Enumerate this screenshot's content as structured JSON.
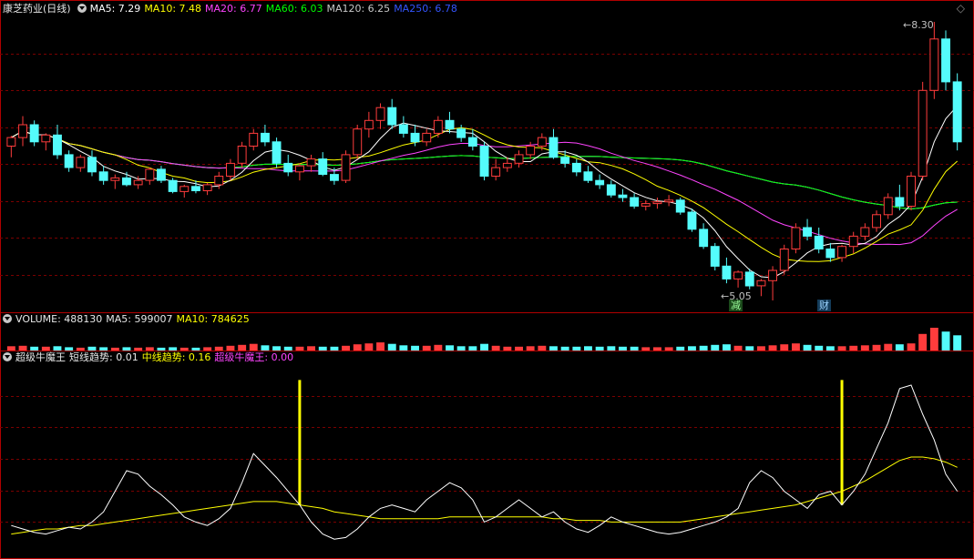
{
  "main": {
    "stock_name": "康芝药业(日线)",
    "ma_labels": [
      {
        "label": "MA5: 7.29",
        "color": "#ffffff"
      },
      {
        "label": "MA10: 7.48",
        "color": "#ffff00"
      },
      {
        "label": "MA20: 6.77",
        "color": "#ff44ff"
      },
      {
        "label": "MA60: 6.03",
        "color": "#00ff00"
      },
      {
        "label": "MA120: 6.25",
        "color": "#c8c8c8"
      },
      {
        "label": "MA250: 6.78",
        "color": "#3355ff"
      }
    ],
    "high_marker": "8.30",
    "low_marker": "5.05",
    "event_reduce": "减",
    "event_finance": "财"
  },
  "volume": {
    "title": "VOLUME: 488130",
    "ma5": "MA5: 599007",
    "ma10": "MA10: 784625"
  },
  "indicator": {
    "title": "超级牛魔王",
    "short": "短线趋势: 0.01",
    "mid": "中线趋势: 0.16",
    "king": "超级牛魔王: 0.00"
  },
  "colors": {
    "up": "#ff3c3c",
    "down": "#54fcfc",
    "grid": "#7a0000",
    "border": "#b00000"
  },
  "chart_data": {
    "type": "candlestick",
    "y_range": [
      5.05,
      8.3
    ],
    "candles": [
      [
        6.85,
        6.97,
        6.72,
        6.95
      ],
      [
        6.95,
        7.2,
        6.85,
        7.1
      ],
      [
        7.1,
        7.15,
        6.85,
        6.9
      ],
      [
        6.9,
        7.0,
        6.8,
        6.98
      ],
      [
        6.98,
        7.1,
        6.7,
        6.75
      ],
      [
        6.75,
        6.8,
        6.55,
        6.6
      ],
      [
        6.6,
        6.75,
        6.55,
        6.72
      ],
      [
        6.72,
        6.8,
        6.5,
        6.55
      ],
      [
        6.55,
        6.62,
        6.4,
        6.45
      ],
      [
        6.45,
        6.52,
        6.35,
        6.48
      ],
      [
        6.48,
        6.55,
        6.38,
        6.4
      ],
      [
        6.4,
        6.5,
        6.35,
        6.45
      ],
      [
        6.45,
        6.6,
        6.4,
        6.58
      ],
      [
        6.58,
        6.62,
        6.42,
        6.45
      ],
      [
        6.45,
        6.48,
        6.3,
        6.32
      ],
      [
        6.32,
        6.4,
        6.25,
        6.38
      ],
      [
        6.38,
        6.45,
        6.3,
        6.33
      ],
      [
        6.33,
        6.42,
        6.28,
        6.4
      ],
      [
        6.4,
        6.55,
        6.35,
        6.5
      ],
      [
        6.5,
        6.7,
        6.45,
        6.65
      ],
      [
        6.65,
        6.9,
        6.6,
        6.85
      ],
      [
        6.85,
        7.05,
        6.8,
        7.0
      ],
      [
        7.0,
        7.1,
        6.85,
        6.9
      ],
      [
        6.9,
        6.95,
        6.6,
        6.65
      ],
      [
        6.65,
        6.75,
        6.5,
        6.55
      ],
      [
        6.55,
        6.65,
        6.45,
        6.62
      ],
      [
        6.62,
        6.75,
        6.55,
        6.7
      ],
      [
        6.7,
        6.78,
        6.5,
        6.52
      ],
      [
        6.52,
        6.6,
        6.4,
        6.45
      ],
      [
        6.45,
        6.8,
        6.42,
        6.75
      ],
      [
        6.75,
        7.1,
        6.7,
        7.05
      ],
      [
        7.05,
        7.25,
        6.95,
        7.15
      ],
      [
        7.15,
        7.35,
        7.05,
        7.3
      ],
      [
        7.3,
        7.4,
        7.05,
        7.1
      ],
      [
        7.1,
        7.2,
        6.95,
        7.0
      ],
      [
        7.0,
        7.1,
        6.85,
        6.9
      ],
      [
        6.9,
        7.05,
        6.85,
        7.0
      ],
      [
        7.0,
        7.2,
        6.95,
        7.15
      ],
      [
        7.15,
        7.25,
        7.0,
        7.05
      ],
      [
        7.05,
        7.1,
        6.9,
        6.95
      ],
      [
        6.95,
        7.05,
        6.8,
        6.85
      ],
      [
        6.85,
        6.9,
        6.45,
        6.5
      ],
      [
        6.5,
        6.7,
        6.45,
        6.6
      ],
      [
        6.6,
        6.72,
        6.55,
        6.65
      ],
      [
        6.65,
        6.8,
        6.6,
        6.75
      ],
      [
        6.75,
        6.9,
        6.7,
        6.85
      ],
      [
        6.85,
        7.0,
        6.8,
        6.95
      ],
      [
        6.95,
        7.05,
        6.7,
        6.72
      ],
      [
        6.72,
        6.8,
        6.6,
        6.65
      ],
      [
        6.65,
        6.7,
        6.5,
        6.55
      ],
      [
        6.55,
        6.62,
        6.42,
        6.45
      ],
      [
        6.45,
        6.52,
        6.35,
        6.4
      ],
      [
        6.4,
        6.45,
        6.25,
        6.28
      ],
      [
        6.28,
        6.35,
        6.2,
        6.25
      ],
      [
        6.25,
        6.3,
        6.12,
        6.15
      ],
      [
        6.15,
        6.22,
        6.1,
        6.18
      ],
      [
        6.18,
        6.25,
        6.12,
        6.2
      ],
      [
        6.2,
        6.28,
        6.15,
        6.22
      ],
      [
        6.22,
        6.25,
        6.05,
        6.08
      ],
      [
        6.08,
        6.12,
        5.85,
        5.88
      ],
      [
        5.88,
        5.95,
        5.65,
        5.68
      ],
      [
        5.68,
        5.72,
        5.4,
        5.45
      ],
      [
        5.45,
        5.55,
        5.25,
        5.3
      ],
      [
        5.3,
        5.4,
        5.2,
        5.38
      ],
      [
        5.38,
        5.42,
        5.18,
        5.22
      ],
      [
        5.22,
        5.3,
        5.1,
        5.28
      ],
      [
        5.28,
        5.45,
        5.05,
        5.4
      ],
      [
        5.4,
        5.7,
        5.35,
        5.65
      ],
      [
        5.65,
        5.95,
        5.6,
        5.9
      ],
      [
        5.9,
        6.0,
        5.75,
        5.8
      ],
      [
        5.8,
        5.9,
        5.6,
        5.65
      ],
      [
        5.65,
        5.72,
        5.5,
        5.55
      ],
      [
        5.55,
        5.7,
        5.5,
        5.68
      ],
      [
        5.68,
        5.85,
        5.6,
        5.8
      ],
      [
        5.8,
        5.95,
        5.75,
        5.9
      ],
      [
        5.9,
        6.1,
        5.85,
        6.05
      ],
      [
        6.05,
        6.3,
        6.0,
        6.25
      ],
      [
        6.25,
        6.4,
        6.1,
        6.15
      ],
      [
        6.15,
        6.55,
        6.1,
        6.5
      ],
      [
        6.5,
        7.6,
        6.45,
        7.5
      ],
      [
        7.5,
        8.3,
        7.4,
        8.1
      ],
      [
        8.1,
        8.2,
        7.5,
        7.6
      ],
      [
        7.6,
        7.7,
        6.8,
        6.9
      ]
    ],
    "volume": [
      9,
      10,
      8,
      8,
      9,
      7,
      6,
      8,
      7,
      6,
      7,
      6,
      7,
      6,
      7,
      6,
      6,
      7,
      8,
      10,
      12,
      14,
      11,
      9,
      8,
      8,
      9,
      8,
      8,
      10,
      13,
      15,
      17,
      14,
      11,
      10,
      10,
      12,
      11,
      9,
      9,
      14,
      10,
      8,
      8,
      9,
      10,
      9,
      8,
      8,
      9,
      8,
      9,
      8,
      8,
      7,
      7,
      7,
      8,
      9,
      10,
      12,
      13,
      10,
      9,
      9,
      11,
      13,
      15,
      12,
      10,
      9,
      9,
      10,
      11,
      12,
      14,
      13,
      15,
      35,
      48,
      40,
      32
    ],
    "indicator_short": [
      0.1,
      0.08,
      0.06,
      0.05,
      0.07,
      0.09,
      0.08,
      0.12,
      0.18,
      0.3,
      0.42,
      0.4,
      0.33,
      0.28,
      0.22,
      0.15,
      0.12,
      0.1,
      0.14,
      0.2,
      0.35,
      0.52,
      0.45,
      0.38,
      0.3,
      0.22,
      0.12,
      0.05,
      0.02,
      0.03,
      0.08,
      0.15,
      0.2,
      0.22,
      0.2,
      0.18,
      0.25,
      0.3,
      0.35,
      0.32,
      0.25,
      0.12,
      0.15,
      0.2,
      0.25,
      0.2,
      0.15,
      0.18,
      0.12,
      0.08,
      0.06,
      0.1,
      0.15,
      0.12,
      0.1,
      0.08,
      0.06,
      0.05,
      0.06,
      0.08,
      0.1,
      0.12,
      0.15,
      0.2,
      0.35,
      0.42,
      0.38,
      0.3,
      0.25,
      0.2,
      0.28,
      0.3,
      0.22,
      0.3,
      0.4,
      0.55,
      0.7,
      0.9,
      0.92,
      0.75,
      0.6,
      0.4,
      0.3
    ],
    "indicator_mid": [
      0.05,
      0.06,
      0.07,
      0.08,
      0.08,
      0.09,
      0.1,
      0.1,
      0.11,
      0.12,
      0.13,
      0.14,
      0.15,
      0.16,
      0.17,
      0.18,
      0.19,
      0.2,
      0.21,
      0.22,
      0.23,
      0.24,
      0.24,
      0.24,
      0.23,
      0.22,
      0.21,
      0.2,
      0.18,
      0.17,
      0.16,
      0.15,
      0.14,
      0.14,
      0.14,
      0.14,
      0.14,
      0.14,
      0.15,
      0.15,
      0.15,
      0.15,
      0.15,
      0.15,
      0.15,
      0.15,
      0.15,
      0.14,
      0.14,
      0.13,
      0.13,
      0.13,
      0.12,
      0.12,
      0.12,
      0.12,
      0.12,
      0.12,
      0.12,
      0.13,
      0.14,
      0.15,
      0.16,
      0.17,
      0.18,
      0.19,
      0.2,
      0.21,
      0.22,
      0.24,
      0.26,
      0.28,
      0.3,
      0.33,
      0.36,
      0.4,
      0.44,
      0.48,
      0.5,
      0.5,
      0.49,
      0.47,
      0.44
    ],
    "indicator_signals": [
      25,
      72
    ]
  }
}
